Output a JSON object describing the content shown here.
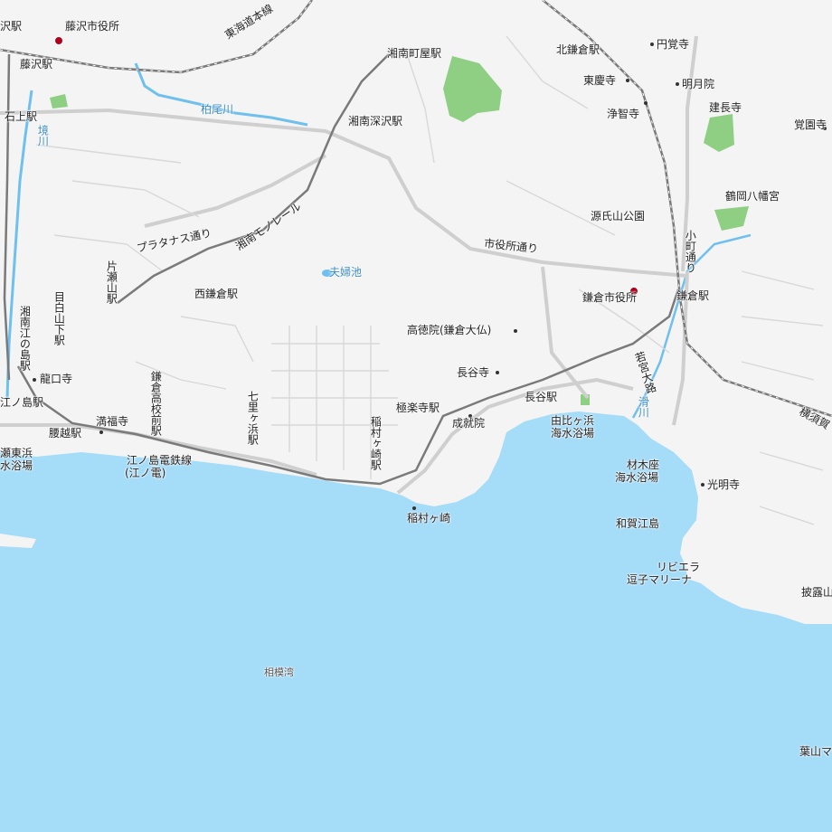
{
  "map": {
    "colors": {
      "land": "#f4f4f4",
      "sea": "#a5dcf8",
      "park": "#8fcf84",
      "road": "#c6c6c6",
      "rail": "#7a7a7a",
      "river": "#6fc0ee",
      "poi": "#b0001a"
    },
    "sea_label": "相模湾",
    "stations": {
      "fujisawa_edge": "沢駅",
      "fujisawa": "藤沢駅",
      "ishigami": "石上駅",
      "shonan_machiya": "湘南町屋駅",
      "shonan_fukasawa": "湘南深沢駅",
      "kita_kamakura": "北鎌倉駅",
      "kamakura": "鎌倉駅",
      "nishi_kamakura": "西鎌倉駅",
      "katase_yama": "片瀬山駅",
      "mejiroyama_shita": "目白山下駅",
      "shonan_enoshima": "湘南江の島駅",
      "enoshima": "江ノ島駅",
      "koshigoe": "腰越駅",
      "kamakura_koko_mae": "鎌倉高校前駅",
      "shichirigahama": "七里ヶ浜駅",
      "inamuragasaki": "稲村ヶ崎駅",
      "gokurakuji": "極楽寺駅",
      "hase": "長谷駅"
    },
    "places": {
      "fujisawa_city_hall": "藤沢市役所",
      "kamakura_city_hall": "鎌倉市役所",
      "engakuji": "円覚寺",
      "tokeiji": "東慶寺",
      "meigetsuin": "明月院",
      "jochiji": "浄智寺",
      "kenchoji": "建長寺",
      "kakuonji": "覚園寺",
      "tsurugaoka": "鶴岡八幡宮",
      "genjiyama": "源氏山公園",
      "kotokuin": "高徳院(鎌倉大仏)",
      "hasedera": "長谷寺",
      "ryukoji": "龍口寺",
      "manpukuji": "満福寺",
      "gokurakuji_temple": "極楽寺駅",
      "jojuin": "成就院",
      "inamuragasaki_cape": "稲村ヶ崎",
      "komyoji": "光明寺",
      "wakaejima": "和賀江島",
      "fufuike": "夫婦池",
      "kashiogawa": "柏尾川",
      "sakaigawa": "境川",
      "namerikawa": "滑川"
    },
    "roads": {
      "tokaido": "東海道本線",
      "shonan_monorail": "湘南モノレール",
      "platanus": "プラタナス通り",
      "shiyakusho_dori": "市役所通り",
      "komachi_dori": "小町通り",
      "wakamiya_oji": "若宮大路",
      "enoden_1": "江ノ島電鉄線",
      "enoden_2": "(江ノ電)",
      "yokosuka": "横須賀"
    },
    "beaches": {
      "katase_1": "瀬東浜",
      "katase_2": "水浴場",
      "yuigahama_1": "由比ヶ浜",
      "yuigahama_2": "海水浴場",
      "zaimokuza_1": "材木座",
      "zaimokuza_2": "海水浴場",
      "riviera_1": "リビエラ",
      "riviera_2": "逗子マリーナ",
      "hayama": "葉山マ",
      "hiroyama": "披露山"
    }
  }
}
